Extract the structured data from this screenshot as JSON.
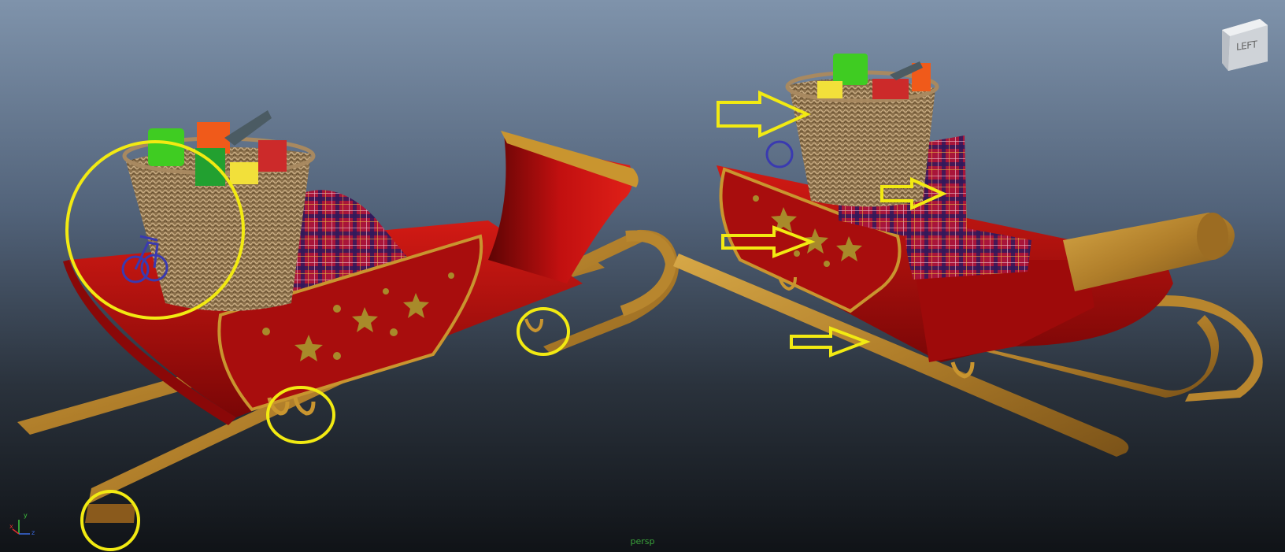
{
  "viewport": {
    "camera": "persp",
    "view_cube_face": "LEFT",
    "background_top": "#7f93ab",
    "background_bottom": "#101317"
  },
  "axis_indicator": {
    "x": "x",
    "y": "y",
    "z": "z"
  },
  "annotations": {
    "color": "#f2ea12",
    "circle_count": 5,
    "arrow_count": 4
  },
  "models": {
    "left": {
      "body_color": "#b30c0c",
      "trim_color": "#c9952f"
    },
    "right": {
      "body_color": "#b30c0c",
      "trim_color": "#c9952f"
    }
  }
}
